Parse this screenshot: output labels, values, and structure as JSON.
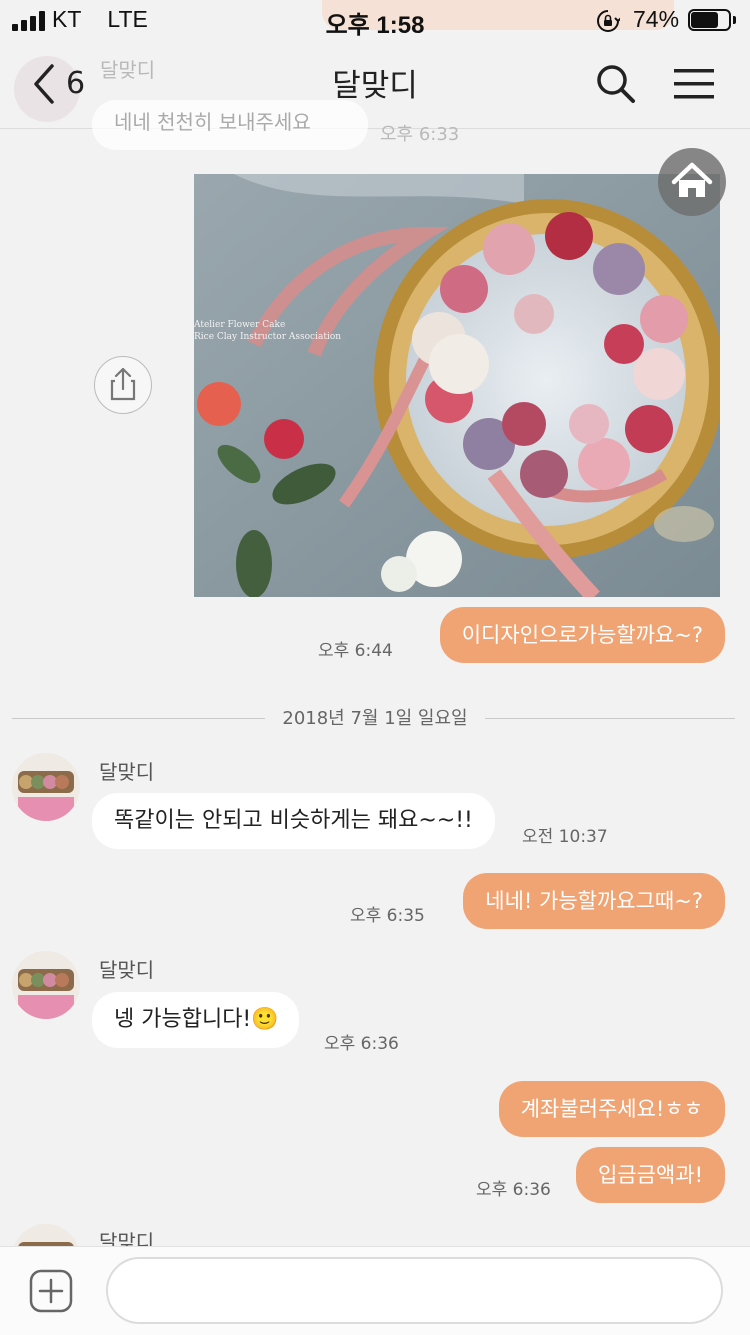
{
  "status_bar": {
    "carrier": "KT",
    "network": "LTE",
    "time": "오후 1:58",
    "battery_percent": "74%",
    "battery_level": 0.74
  },
  "header": {
    "back_count": "6",
    "title": "달맞디",
    "partial_sender": "달맞디",
    "partial_message": "네네 천천히 보내주세요",
    "partial_time": "오후 6:33"
  },
  "photo": {
    "caption_line1": "Atelier Flower Cake",
    "caption_line2": "Rice Clay Instructor Association"
  },
  "messages": {
    "m1": {
      "text": "이디자인으로가능할까요~?",
      "time": "오후 6:44"
    },
    "date_divider": "2018년 7월 1일 일요일",
    "m2": {
      "sender": "달맞디",
      "text": "똑같이는 안되고 비슷하게는 돼요~~!!",
      "time": "오전 10:37"
    },
    "m3": {
      "text": "네네! 가능할까요그때~?",
      "time": "오후 6:35"
    },
    "m4": {
      "sender": "달맞디",
      "text": "넹 가능합니다!",
      "emoji": "🙂",
      "time": "오후 6:36"
    },
    "m5": {
      "text": "계좌불러주세요!ㅎㅎ"
    },
    "m6": {
      "text": "입금금액과!",
      "time": "오후 6:36"
    },
    "m7": {
      "sender": "달맞디"
    }
  },
  "input": {
    "placeholder": ""
  },
  "colors": {
    "outgoing_bubble": "#f0a474",
    "incoming_bubble": "#ffffff",
    "background": "#f2f2f2"
  }
}
